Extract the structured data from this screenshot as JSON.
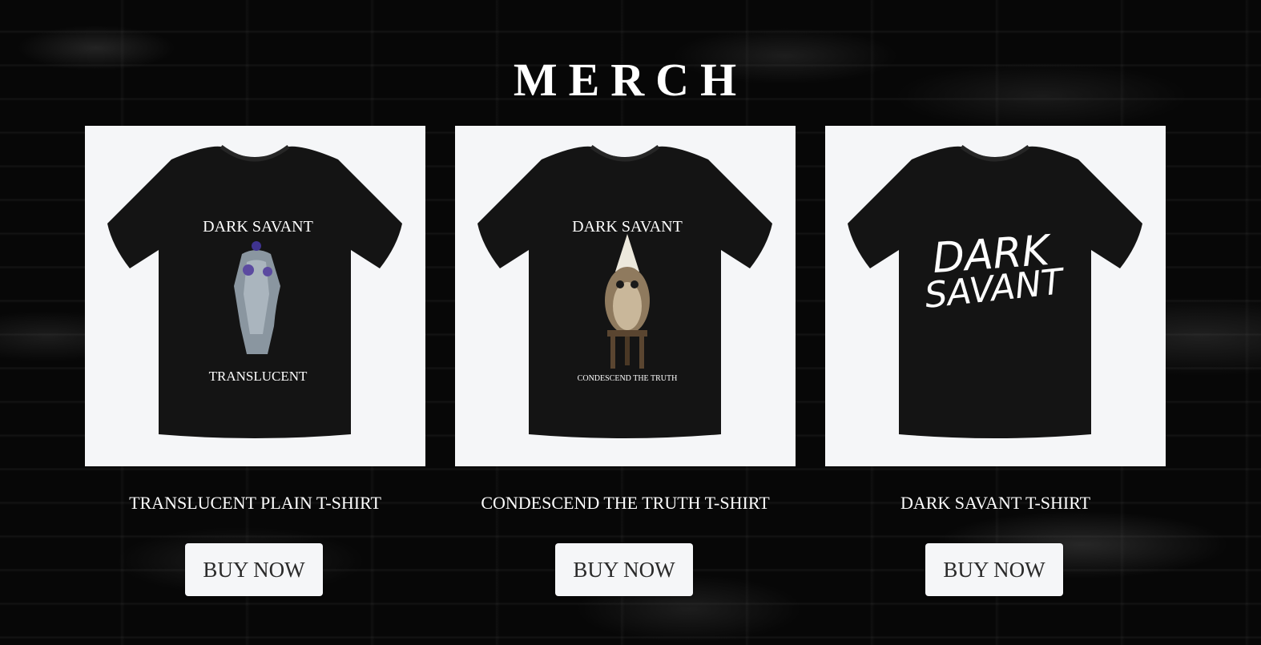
{
  "page": {
    "title": "MERCH"
  },
  "products": [
    {
      "name": "TRANSLUCENT PLAIN T-SHIRT",
      "button_label": "BUY NOW",
      "shirt_text_top": "DARK SAVANT",
      "shirt_text_bottom": "TRANSLUCENT"
    },
    {
      "name": "CONDESCEND THE TRUTH T-SHIRT",
      "button_label": "BUY NOW",
      "shirt_text_top": "DARK SAVANT",
      "shirt_text_bottom": "CONDESCEND THE TRUTH"
    },
    {
      "name": "DARK SAVANT T-SHIRT",
      "button_label": "BUY NOW",
      "shirt_text_top": "DARK",
      "shirt_text_bottom": "SAVANT"
    }
  ],
  "colors": {
    "background": "#070707",
    "card_background": "#f5f6f8",
    "shirt": "#141414",
    "button_text": "#2a2a2a"
  }
}
